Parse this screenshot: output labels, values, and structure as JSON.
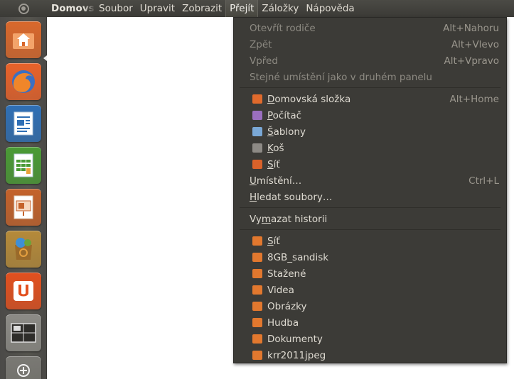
{
  "panel": {
    "app_name": "Domovská složka",
    "menus": [
      "Soubor",
      "Upravit",
      "Zobrazit",
      "Přejít",
      "Záložky",
      "Nápověda"
    ]
  },
  "launcher": {
    "items": [
      {
        "name": "home-folder",
        "color": "#d9682c"
      },
      {
        "name": "firefox",
        "color": "#e8622a"
      },
      {
        "name": "libreoffice-writer",
        "color": "#2f6fb5"
      },
      {
        "name": "libreoffice-calc",
        "color": "#4a9a35"
      },
      {
        "name": "libreoffice-impress",
        "color": "#c4622b"
      },
      {
        "name": "ubuntu-software-center",
        "color": "#b58a3a"
      },
      {
        "name": "ubuntu-one",
        "color": "#e2501f"
      },
      {
        "name": "workspace-switcher",
        "color": "#8c8b86"
      },
      {
        "name": "dash-apps",
        "color": "#7a7974"
      }
    ]
  },
  "goto_menu": {
    "items": [
      {
        "type": "item",
        "label": "Otevřít rodiče",
        "accel": "Alt+Nahoru",
        "disabled": true
      },
      {
        "type": "item",
        "label": "Zpět",
        "accel": "Alt+Vlevo",
        "disabled": true
      },
      {
        "type": "item",
        "label": "Vpřed",
        "accel": "Alt+Vpravo",
        "disabled": true
      },
      {
        "type": "item",
        "label": "Stejné umístění jako v druhém panelu",
        "accel": "",
        "disabled": true
      },
      {
        "type": "separator"
      },
      {
        "type": "item",
        "label": "Domovská složka",
        "accel": "Alt+Home",
        "icon": "home-folder-icon",
        "icon_color": "#e06a2c"
      },
      {
        "type": "item",
        "label": "Počítač",
        "accel": "",
        "icon": "computer-icon",
        "icon_color": "#9b6fbf"
      },
      {
        "type": "item",
        "label": "Šablony",
        "accel": "",
        "icon": "templates-icon",
        "icon_color": "#7aa8d6"
      },
      {
        "type": "item",
        "label": "Koš",
        "accel": "",
        "icon": "trash-icon",
        "icon_color": "#8d8a85"
      },
      {
        "type": "item",
        "label": "Síť",
        "accel": "",
        "icon": "network-icon",
        "icon_color": "#d9622a"
      },
      {
        "type": "item",
        "label": "Umístění…",
        "accel": "Ctrl+L"
      },
      {
        "type": "item",
        "label": "Hledat soubory…",
        "accel": ""
      },
      {
        "type": "separator"
      },
      {
        "type": "item",
        "label": "Vymazat historii",
        "accel": ""
      },
      {
        "type": "separator"
      },
      {
        "type": "item",
        "label": "Síť",
        "accel": "",
        "icon": "folder-icon",
        "icon_color": "#e2782e"
      },
      {
        "type": "item",
        "label": "8GB_sandisk",
        "accel": "",
        "icon": "folder-icon",
        "icon_color": "#e2782e"
      },
      {
        "type": "item",
        "label": "Stažené",
        "accel": "",
        "icon": "downloads-folder-icon",
        "icon_color": "#e2782e"
      },
      {
        "type": "item",
        "label": "Videa",
        "accel": "",
        "icon": "videos-folder-icon",
        "icon_color": "#e2782e"
      },
      {
        "type": "item",
        "label": "Obrázky",
        "accel": "",
        "icon": "pictures-folder-icon",
        "icon_color": "#e2782e"
      },
      {
        "type": "item",
        "label": "Hudba",
        "accel": "",
        "icon": "music-folder-icon",
        "icon_color": "#e2782e"
      },
      {
        "type": "item",
        "label": "Dokumenty",
        "accel": "",
        "icon": "documents-folder-icon",
        "icon_color": "#e2782e"
      },
      {
        "type": "item",
        "label": "krr2011jpeg",
        "accel": "",
        "icon": "folder-icon",
        "icon_color": "#e2782e"
      }
    ]
  }
}
